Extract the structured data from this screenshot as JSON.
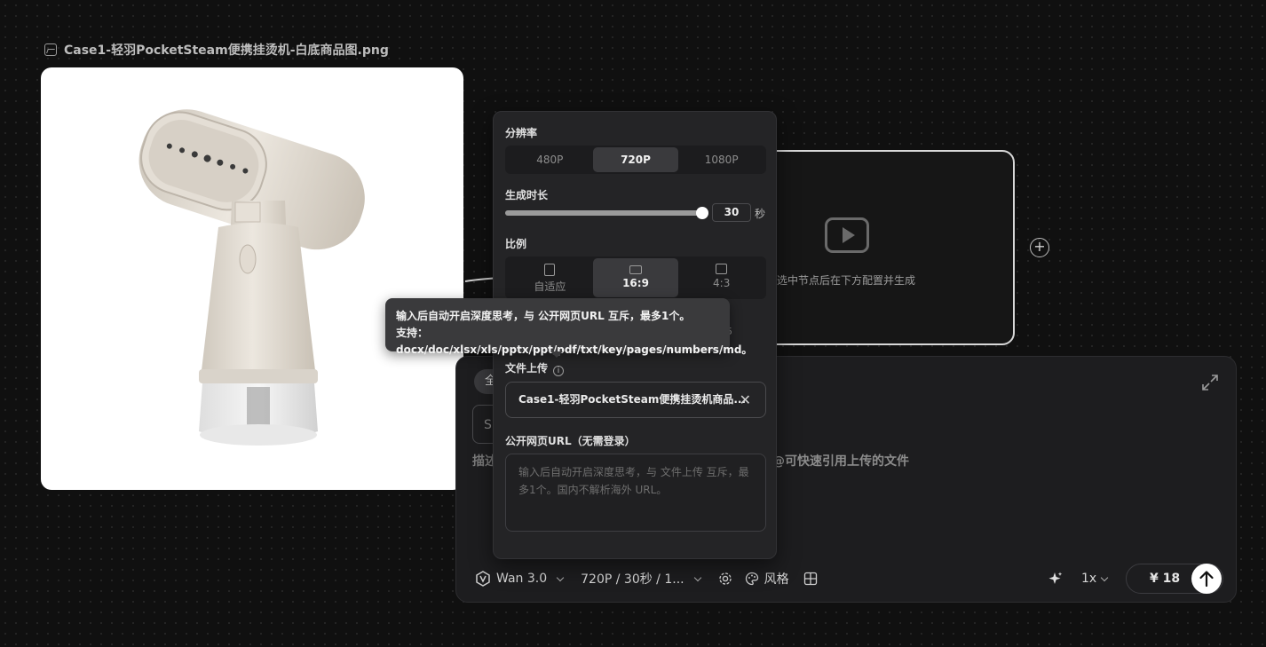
{
  "image_node": {
    "title": "Case1-轻羽PocketSteam便携挂烫机-白底商品图.png"
  },
  "video_node": {
    "hint": "选中节点后在下方配置并生成"
  },
  "popover": {
    "resolution_label": "分辨率",
    "resolution_options": [
      "480P",
      "720P",
      "1080P"
    ],
    "resolution_selected": "720P",
    "duration_label": "生成时长",
    "duration_value": "30",
    "duration_max": 30,
    "duration_unit": "秒",
    "ratio_label": "比例",
    "ratio_options": [
      "自适应",
      "16:9",
      "4:3"
    ],
    "ratio_selected": "16:9",
    "file_upload_label": "文件上传",
    "file_name": "Case1-轻羽PocketSteam便携挂烫机商品...",
    "url_label": "公开网页URL（无需登录）",
    "url_placeholder": "输入后自动开启深度思考，与 文件上传 互斥，最多1个。国内不解析海外 URL。"
  },
  "tooltip": {
    "line1": "输入后自动开启深度思考，与 公开网页URL 互斥，最多1个。",
    "line2": "支持：docx/doc/xlsx/xls/pptx/ppt/pdf/txt/key/pages/numbers/md。"
  },
  "prompt_panel": {
    "chip_partial": "全",
    "box_partial": "S",
    "desc_left": "描述",
    "desc_right": "@可快速引用上传的文件",
    "behind_text": "5"
  },
  "toolbar": {
    "model": "Wan 3.0",
    "params": "720P / 30秒 / 1...",
    "style_label": "风格",
    "multiplier": "1x",
    "price": "¥ 18"
  },
  "colors": {
    "canvas_bg": "#101010",
    "panel_bg": "#1d1d1f",
    "popover_bg": "#242426",
    "accent_white": "#ffffff"
  }
}
